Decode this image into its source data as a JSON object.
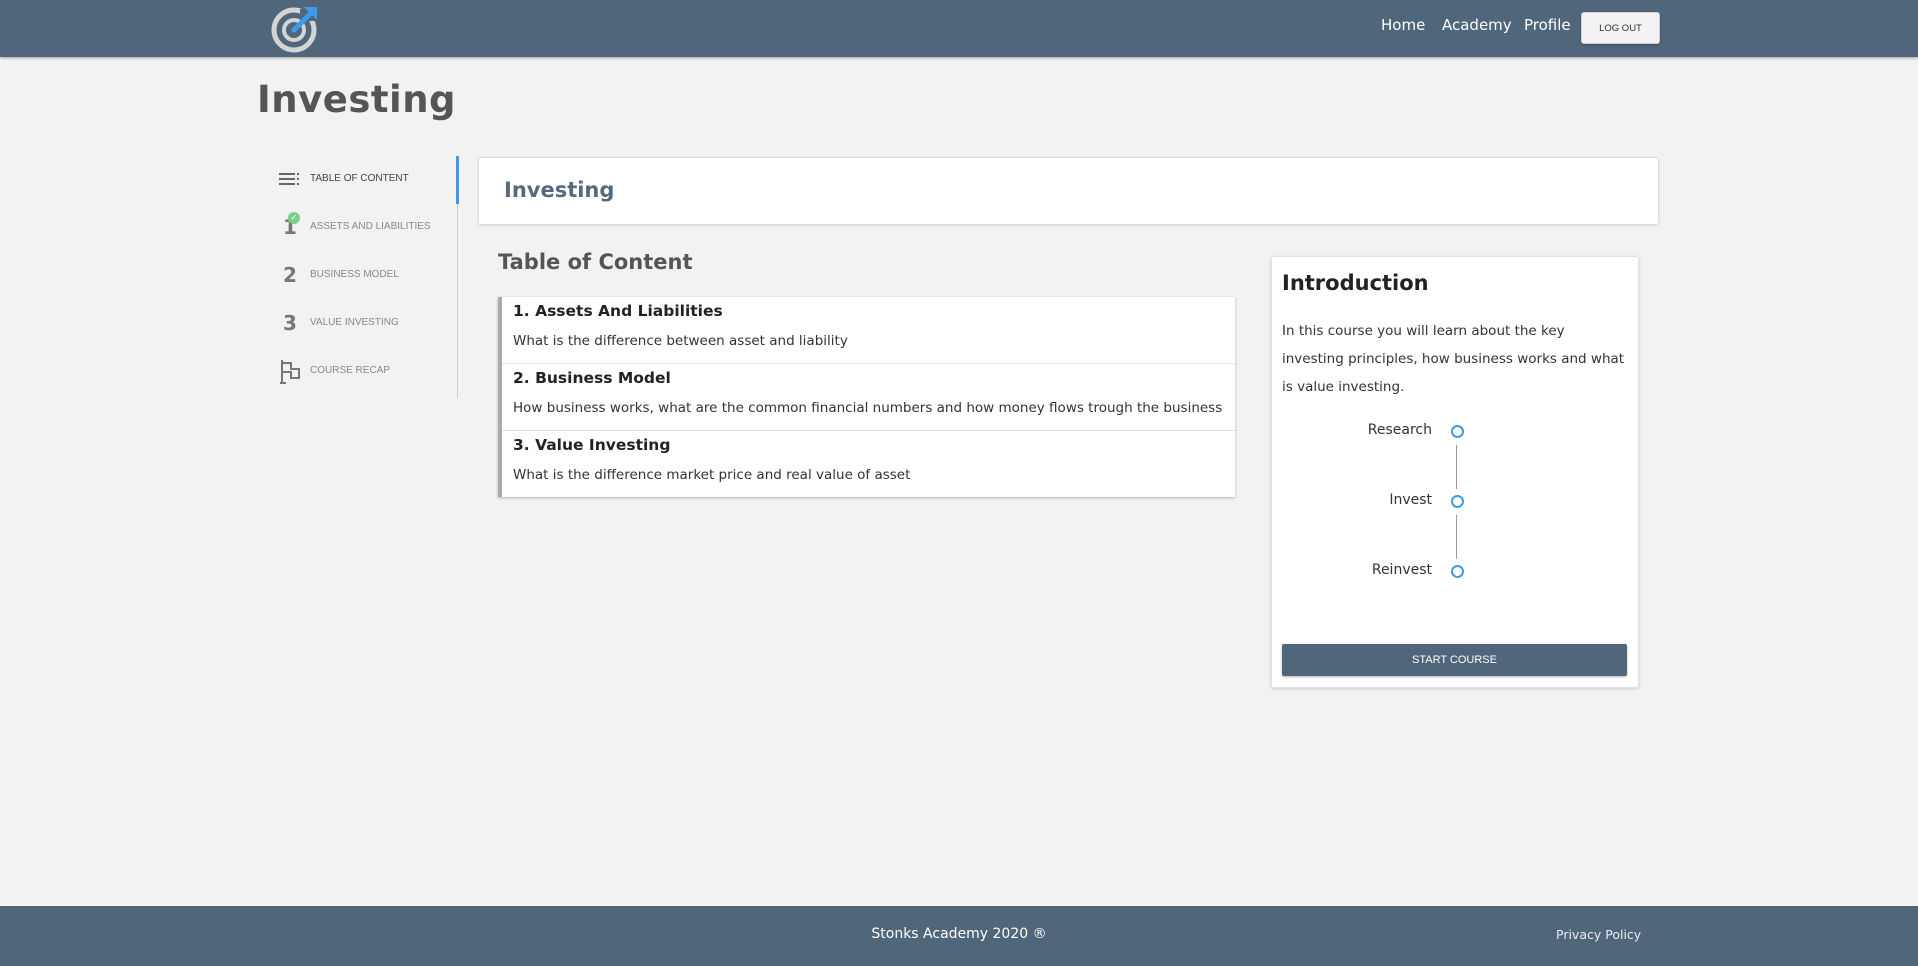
{
  "header": {
    "nav": [
      "Home",
      "Academy",
      "Profile"
    ],
    "logout_label": "LOG OUT"
  },
  "page": {
    "title": "Investing"
  },
  "sidebar": {
    "items": [
      {
        "label": "TABLE OF CONTENT",
        "icon": "list-icon",
        "active": true
      },
      {
        "label": "ASSETS AND LIABILITIES",
        "number": "1",
        "completed": true
      },
      {
        "label": "BUSINESS MODEL",
        "number": "2"
      },
      {
        "label": "VALUE INVESTING",
        "number": "3"
      },
      {
        "label": "COURSE RECAP",
        "icon": "flag-icon"
      }
    ]
  },
  "course_header": {
    "title": "Investing"
  },
  "toc": {
    "title": "Table of Content",
    "items": [
      {
        "title": "1. Assets And Liabilities",
        "desc": "What is the difference between asset and liability"
      },
      {
        "title": "2. Business Model",
        "desc": "How business works, what are the common financial numbers and how money flows trough the business"
      },
      {
        "title": "3. Value Investing",
        "desc": "What is the difference market price and real value of asset"
      }
    ]
  },
  "intro": {
    "title": "Introduction",
    "text": "In this course you will learn about the key investing principles, how business works and what is value investing.",
    "steps": [
      "Research",
      "Invest",
      "Reinvest"
    ],
    "start_label": "START COURSE"
  },
  "footer": {
    "copyright": "Stonks Academy 2020 ®",
    "privacy": "Privacy Policy"
  },
  "colors": {
    "brand": "#50667b",
    "accent": "#3d9be9",
    "success": "#7bd089",
    "background": "#f2f2f2"
  }
}
